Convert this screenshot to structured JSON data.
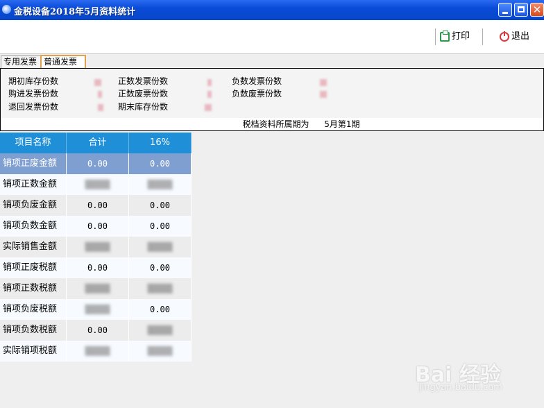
{
  "window": {
    "title": "金税设备2018年5月资料统计"
  },
  "toolbar": {
    "print_label": "打印",
    "exit_label": "退出",
    "print_icon": "printer-icon",
    "exit_icon": "power-icon"
  },
  "tabs": [
    {
      "label": "专用发票",
      "active": false
    },
    {
      "label": "普通发票",
      "active": true
    }
  ],
  "stats": {
    "col1": [
      "期初库存份数",
      "购进发票份数",
      "退回发票份数"
    ],
    "col2": [
      "正数发票份数",
      "正数废票份数",
      "期末库存份数"
    ],
    "col3": [
      "负数发票份数",
      "负数废票份数"
    ]
  },
  "period": {
    "label": "税档资料所属期为",
    "value": "5月第1期"
  },
  "table": {
    "headers": [
      "项目名称",
      "合计",
      "16%"
    ],
    "rows": [
      {
        "name": "销项正废金额",
        "total": "0.00",
        "rate": "0.00"
      },
      {
        "name": "销项正数金额",
        "total": "",
        "rate": ""
      },
      {
        "name": "销项负废金额",
        "total": "0.00",
        "rate": "0.00"
      },
      {
        "name": "销项负数金额",
        "total": "0.00",
        "rate": "0.00"
      },
      {
        "name": "实际销售金额",
        "total": "",
        "rate": ""
      },
      {
        "name": "销项正废税额",
        "total": "0.00",
        "rate": "0.00"
      },
      {
        "name": "销项正数税额",
        "total": "",
        "rate": ""
      },
      {
        "name": "销项负废税额",
        "total": "",
        "rate": "0.00"
      },
      {
        "name": "销项负数税额",
        "total": "0.00",
        "rate": ""
      },
      {
        "name": "实际销项税额",
        "total": "",
        "rate": ""
      }
    ]
  },
  "watermark": {
    "brand": "Bai 经验",
    "url": "jingyan.baidu.com"
  },
  "colors": {
    "titlebar": "#0a4bd8",
    "header": "#1f8fd8",
    "selected_row": "#7f9fd0"
  }
}
